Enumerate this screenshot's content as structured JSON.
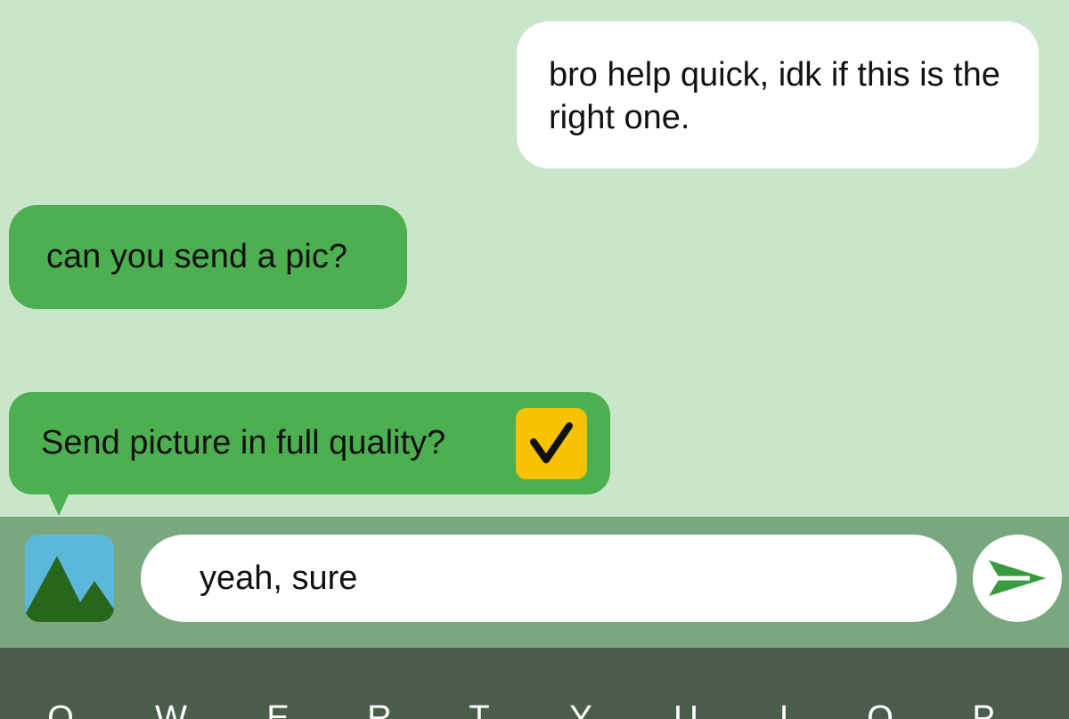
{
  "messages": {
    "outgoing": "bro help quick, idk if this is the right one.",
    "incoming": "can you send a pic?",
    "prompt": "Send picture in full quality?"
  },
  "prompt_checkbox": {
    "checked": true,
    "icon": "checkmark-icon",
    "color": "#f7c200"
  },
  "composer": {
    "text": "yeah, sure",
    "gallery_icon": "image-gallery-icon",
    "send_icon": "send-arrow-icon"
  },
  "keyboard": {
    "keys": [
      "Q",
      "W",
      "E",
      "R",
      "T",
      "Y",
      "U",
      "I",
      "O",
      "P"
    ]
  },
  "colors": {
    "background": "#c9e6cb",
    "incoming_bubble": "#4caf50",
    "outgoing_bubble": "#ffffff",
    "composer_bar": "#7aa87e",
    "keyboard": "#4a5e4b",
    "send_arrow": "#3a9a40"
  }
}
